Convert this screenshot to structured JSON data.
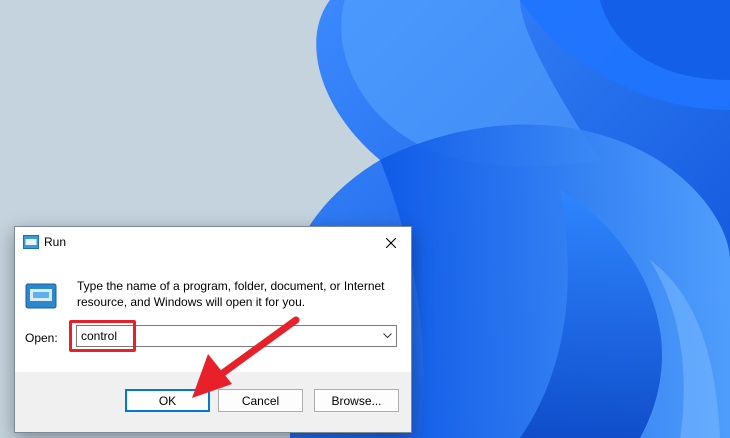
{
  "dialog": {
    "title": "Run",
    "description": "Type the name of a program, folder, document, or Internet resource, and Windows will open it for you.",
    "open_label": "Open:",
    "open_value": "control",
    "ok_label": "OK",
    "cancel_label": "Cancel",
    "browse_label": "Browse...",
    "close_icon": "close-icon",
    "dropdown_icon": "chevron-down-icon"
  },
  "annotations": {
    "highlight_color": "#e8202a",
    "arrow_color": "#e8202a"
  },
  "colors": {
    "wallpaper_background": "#c5d3de",
    "wallpaper_bloom": "#1a6ef0",
    "dialog_face": "#f0f0f0",
    "default_button_border": "#0078d7"
  }
}
